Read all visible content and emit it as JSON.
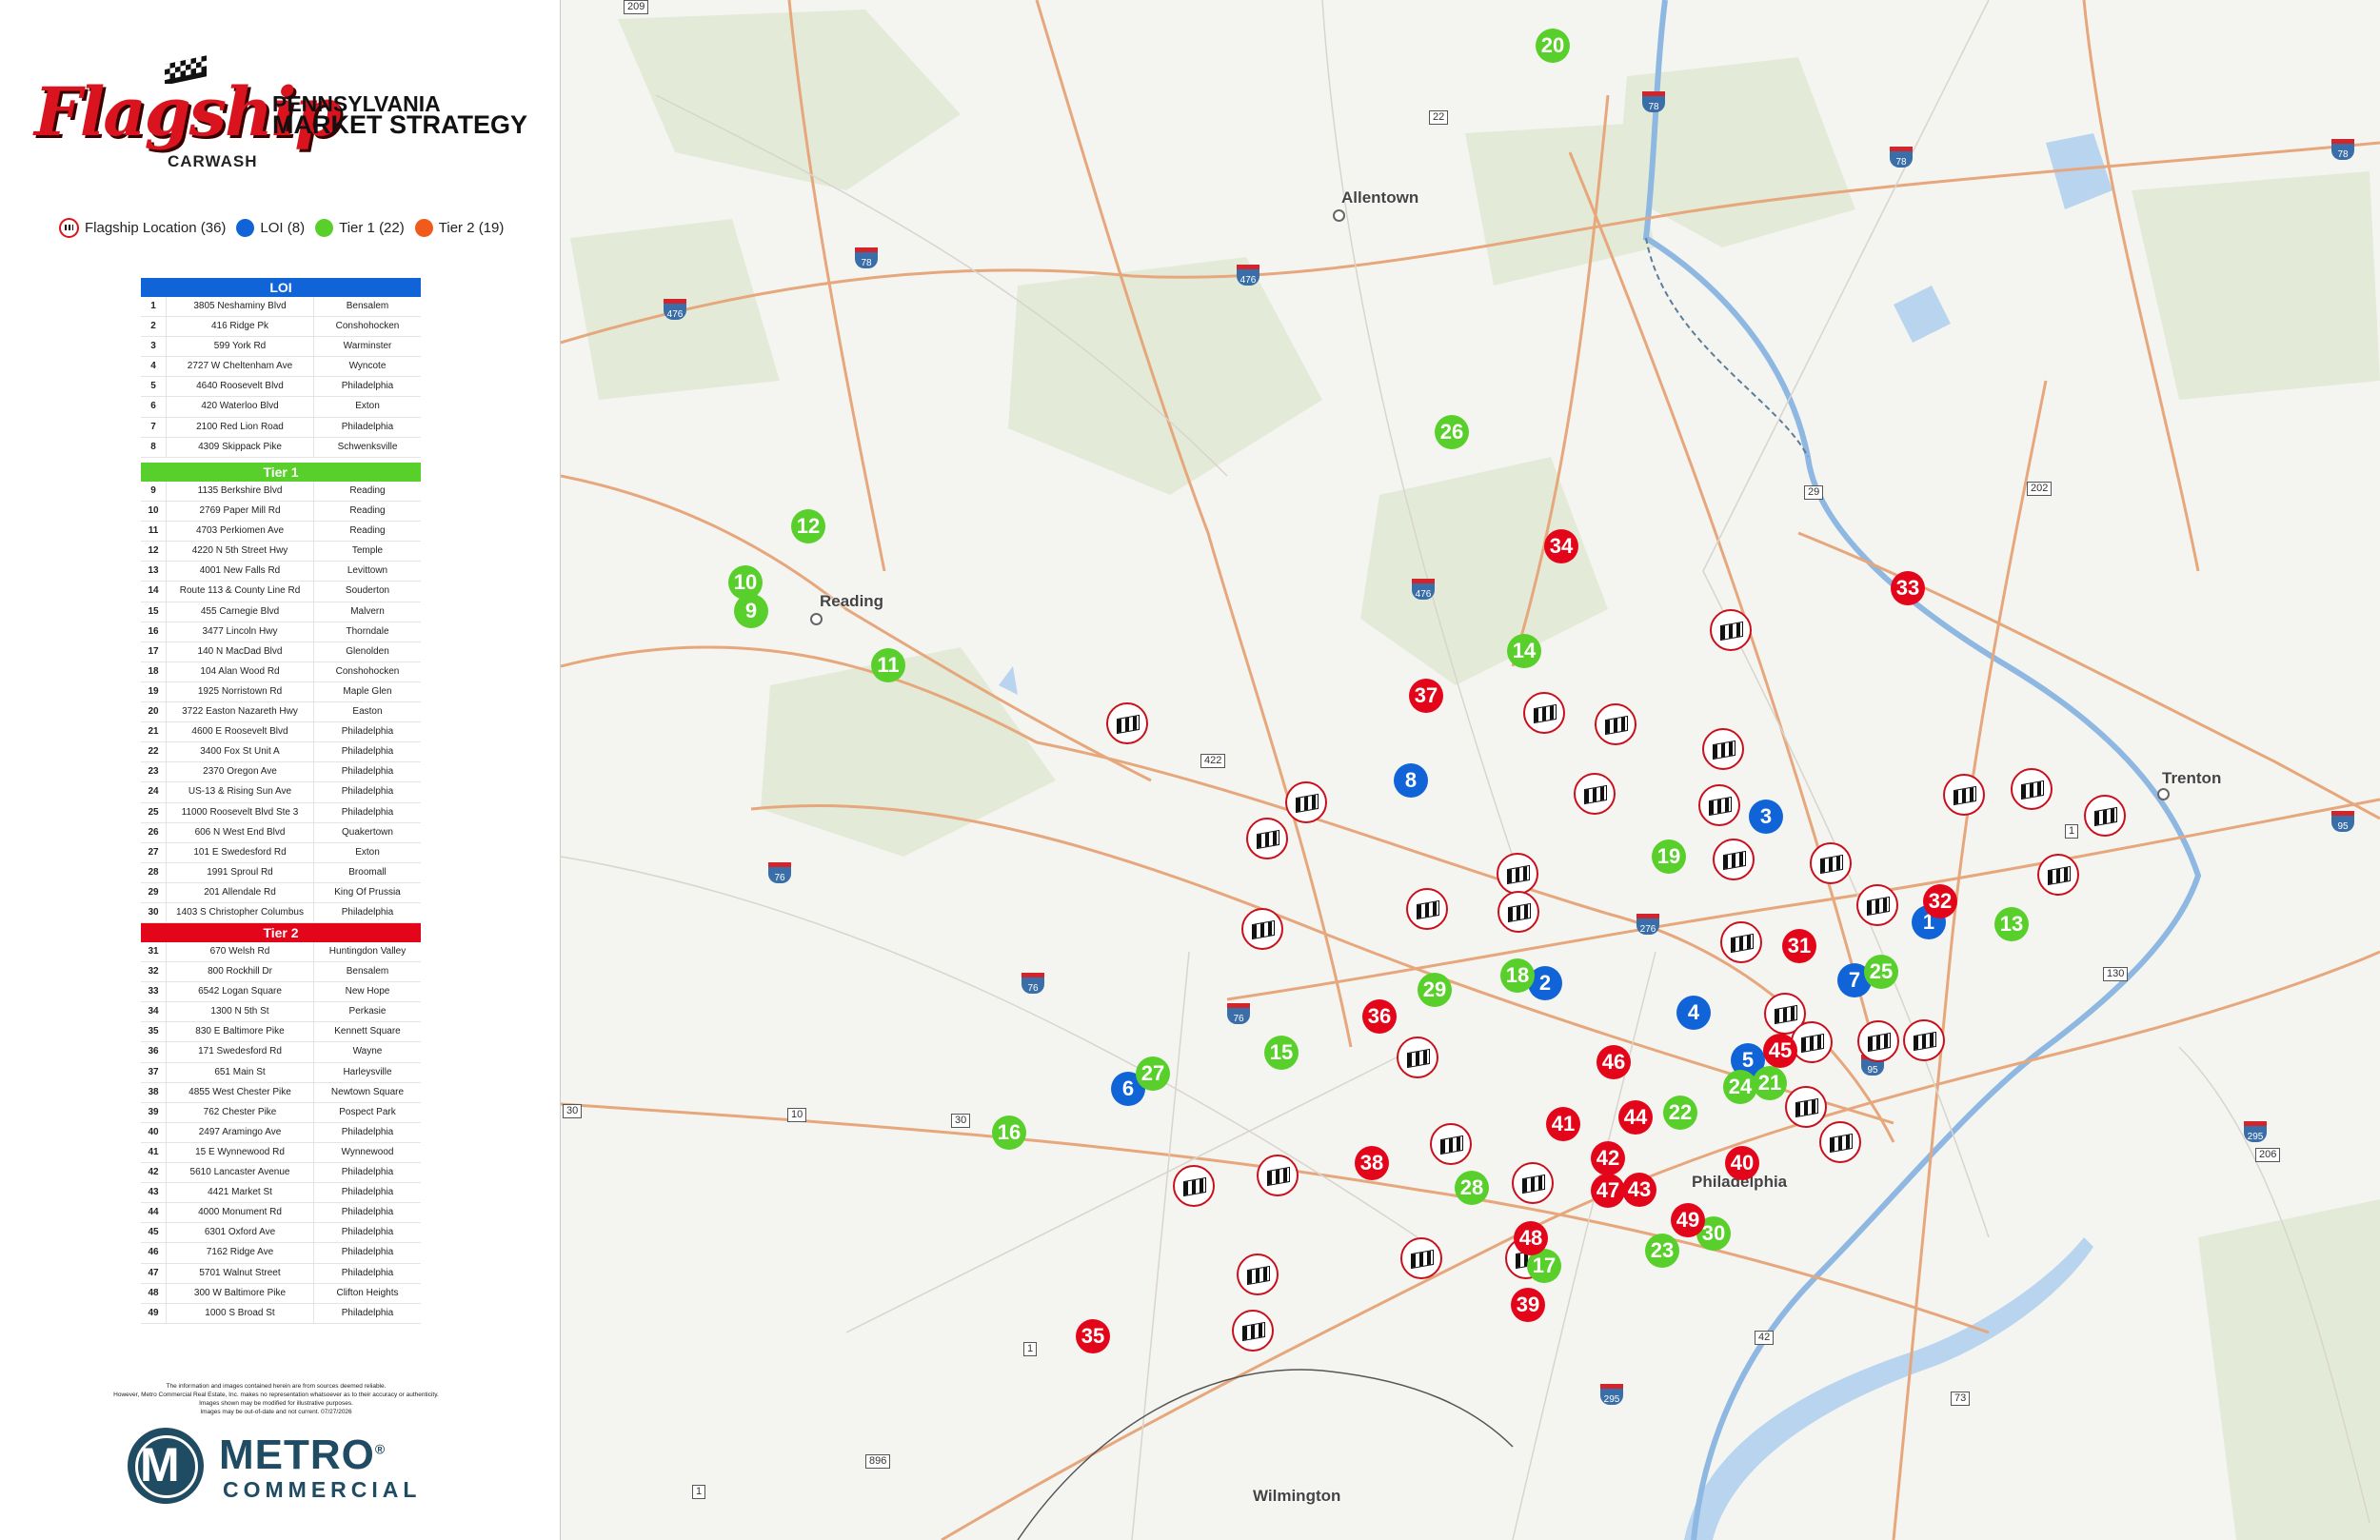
{
  "header": {
    "brand_word": "Flagship",
    "brand_sub": "CARWASH",
    "title_line1": "PENNSYLVANIA",
    "title_line2": "MARKET STRATEGY"
  },
  "legend": [
    {
      "label": "Flagship Location (36)",
      "kind": "flag"
    },
    {
      "label": "LOI (8)",
      "color": "#1164d7"
    },
    {
      "label": "Tier 1 (22)",
      "color": "#59cf2b"
    },
    {
      "label": "Tier 2 (19)",
      "color": "#f05a1a"
    }
  ],
  "tables": [
    {
      "title": "LOI",
      "color": "#1164d7",
      "rows": [
        [
          "1",
          "3805 Neshaminy Blvd",
          "Bensalem"
        ],
        [
          "2",
          "416 Ridge Pk",
          "Conshohocken"
        ],
        [
          "3",
          "599 York Rd",
          "Warminster"
        ],
        [
          "4",
          "2727 W Cheltenham Ave",
          "Wyncote"
        ],
        [
          "5",
          "4640 Roosevelt Blvd",
          "Philadelphia"
        ],
        [
          "6",
          "420 Waterloo Blvd",
          "Exton"
        ],
        [
          "7",
          "2100 Red Lion Road",
          "Philadelphia"
        ],
        [
          "8",
          "4309 Skippack Pike",
          "Schwenksville"
        ]
      ]
    },
    {
      "title": "Tier 1",
      "color": "#59cf2b",
      "rows": [
        [
          "9",
          "1135 Berkshire Blvd",
          "Reading"
        ],
        [
          "10",
          "2769 Paper Mill Rd",
          "Reading"
        ],
        [
          "11",
          "4703 Perkiomen Ave",
          "Reading"
        ],
        [
          "12",
          "4220 N 5th Street Hwy",
          "Temple"
        ],
        [
          "13",
          "4001 New Falls Rd",
          "Levittown"
        ],
        [
          "14",
          "Route 113 & County Line Rd",
          "Souderton"
        ],
        [
          "15",
          "455 Carnegie Blvd",
          "Malvern"
        ],
        [
          "16",
          "3477 Lincoln Hwy",
          "Thorndale"
        ],
        [
          "17",
          "140 N MacDad Blvd",
          "Glenolden"
        ],
        [
          "18",
          "104 Alan Wood Rd",
          "Conshohocken"
        ],
        [
          "19",
          "1925 Norristown Rd",
          "Maple Glen"
        ],
        [
          "20",
          "3722 Easton Nazareth Hwy",
          "Easton"
        ],
        [
          "21",
          "4600 E Roosevelt Blvd",
          "Philadelphia"
        ],
        [
          "22",
          "3400 Fox St Unit A",
          "Philadelphia"
        ],
        [
          "23",
          "2370 Oregon Ave",
          "Philadelphia"
        ],
        [
          "24",
          "US-13 & Rising Sun Ave",
          "Philadelphia"
        ],
        [
          "25",
          "11000 Roosevelt Blvd Ste 3",
          "Philadelphia"
        ],
        [
          "26",
          "606 N West End Blvd",
          "Quakertown"
        ],
        [
          "27",
          "101 E Swedesford Rd",
          "Exton"
        ],
        [
          "28",
          "1991 Sproul Rd",
          "Broomall"
        ],
        [
          "29",
          "201 Allendale Rd",
          "King Of Prussia"
        ],
        [
          "30",
          "1403 S Christopher Columbus Blvd",
          "Philadelphia"
        ]
      ]
    },
    {
      "title": "Tier 2",
      "color": "#e3061a",
      "rows": [
        [
          "31",
          "670 Welsh Rd",
          "Huntingdon Valley"
        ],
        [
          "32",
          "800 Rockhill Dr",
          "Bensalem"
        ],
        [
          "33",
          "6542 Logan Square",
          "New Hope"
        ],
        [
          "34",
          "1300 N 5th St",
          "Perkasie"
        ],
        [
          "35",
          "830 E Baltimore Pike",
          "Kennett Square"
        ],
        [
          "36",
          "171 Swedesford Rd",
          "Wayne"
        ],
        [
          "37",
          "651 Main St",
          "Harleysville"
        ],
        [
          "38",
          "4855 West Chester Pike",
          "Newtown Square"
        ],
        [
          "39",
          "762 Chester Pike",
          "Pospect Park"
        ],
        [
          "40",
          "2497 Aramingo Ave",
          "Philadelphia"
        ],
        [
          "41",
          "15 E Wynnewood Rd",
          "Wynnewood"
        ],
        [
          "42",
          "5610 Lancaster Avenue",
          "Philadelphia"
        ],
        [
          "43",
          "4421 Market St",
          "Philadelphia"
        ],
        [
          "44",
          "4000 Monument Rd",
          "Philadelphia"
        ],
        [
          "45",
          "6301 Oxford Ave",
          "Philadelphia"
        ],
        [
          "46",
          "7162 Ridge Ave",
          "Philadelphia"
        ],
        [
          "47",
          "5701 Walnut Street",
          "Philadelphia"
        ],
        [
          "48",
          "300 W Baltimore Pike",
          "Clifton Heights"
        ],
        [
          "49",
          "1000 S Broad St",
          "Philadelphia"
        ]
      ]
    }
  ],
  "disclaimer": [
    "The information and images contained herein are from sources deemed reliable.",
    "However, Metro Commercial Real Estate, Inc. makes no representation whatsoever as to their accuracy or authenticity.",
    "Images shown may be modified for illustrative purposes.",
    "Images may be out-of-date and not current. 07/27/2026"
  ],
  "metro": {
    "word1": "METRO",
    "word2": "COMMERCIAL",
    "registered": "®"
  },
  "map": {
    "cities": [
      "Allentown",
      "Reading",
      "Trenton",
      "Philadelphia",
      "Wilmington"
    ],
    "route_labels": [
      "209",
      "22",
      "78",
      "78",
      "78",
      "78",
      "476",
      "476",
      "476",
      "29",
      "202",
      "422",
      "76",
      "76",
      "76",
      "276",
      "1",
      "95",
      "130",
      "295",
      "206",
      "30",
      "10",
      "30",
      "1",
      "42",
      "295",
      "73",
      "896",
      "1",
      "95"
    ],
    "markers": [
      {
        "n": "1",
        "tier": "loi"
      },
      {
        "n": "2",
        "tier": "loi"
      },
      {
        "n": "3",
        "tier": "loi"
      },
      {
        "n": "4",
        "tier": "loi"
      },
      {
        "n": "5",
        "tier": "loi"
      },
      {
        "n": "6",
        "tier": "loi"
      },
      {
        "n": "7",
        "tier": "loi"
      },
      {
        "n": "8",
        "tier": "loi"
      },
      {
        "n": "9",
        "tier": "t1"
      },
      {
        "n": "10",
        "tier": "t1"
      },
      {
        "n": "11",
        "tier": "t1"
      },
      {
        "n": "12",
        "tier": "t1"
      },
      {
        "n": "13",
        "tier": "t1"
      },
      {
        "n": "14",
        "tier": "t1"
      },
      {
        "n": "15",
        "tier": "t1"
      },
      {
        "n": "16",
        "tier": "t1"
      },
      {
        "n": "17",
        "tier": "t1"
      },
      {
        "n": "18",
        "tier": "t1"
      },
      {
        "n": "19",
        "tier": "t1"
      },
      {
        "n": "20",
        "tier": "t1"
      },
      {
        "n": "21",
        "tier": "t1"
      },
      {
        "n": "22",
        "tier": "t1"
      },
      {
        "n": "23",
        "tier": "t1"
      },
      {
        "n": "24",
        "tier": "t1"
      },
      {
        "n": "25",
        "tier": "t1"
      },
      {
        "n": "26",
        "tier": "t1"
      },
      {
        "n": "27",
        "tier": "t1"
      },
      {
        "n": "28",
        "tier": "t1"
      },
      {
        "n": "29",
        "tier": "t1"
      },
      {
        "n": "30",
        "tier": "t1"
      },
      {
        "n": "31",
        "tier": "t2"
      },
      {
        "n": "32",
        "tier": "t2"
      },
      {
        "n": "33",
        "tier": "t2"
      },
      {
        "n": "34",
        "tier": "t2"
      },
      {
        "n": "35",
        "tier": "t2"
      },
      {
        "n": "36",
        "tier": "t2"
      },
      {
        "n": "37",
        "tier": "t2"
      },
      {
        "n": "38",
        "tier": "t2"
      },
      {
        "n": "39",
        "tier": "t2"
      },
      {
        "n": "40",
        "tier": "t2"
      },
      {
        "n": "41",
        "tier": "t2"
      },
      {
        "n": "42",
        "tier": "t2"
      },
      {
        "n": "43",
        "tier": "t2"
      },
      {
        "n": "44",
        "tier": "t2"
      },
      {
        "n": "45",
        "tier": "t2"
      },
      {
        "n": "46",
        "tier": "t2"
      },
      {
        "n": "47",
        "tier": "t2"
      },
      {
        "n": "48",
        "tier": "t2"
      },
      {
        "n": "49",
        "tier": "t2"
      }
    ],
    "flagship_count": 36
  }
}
